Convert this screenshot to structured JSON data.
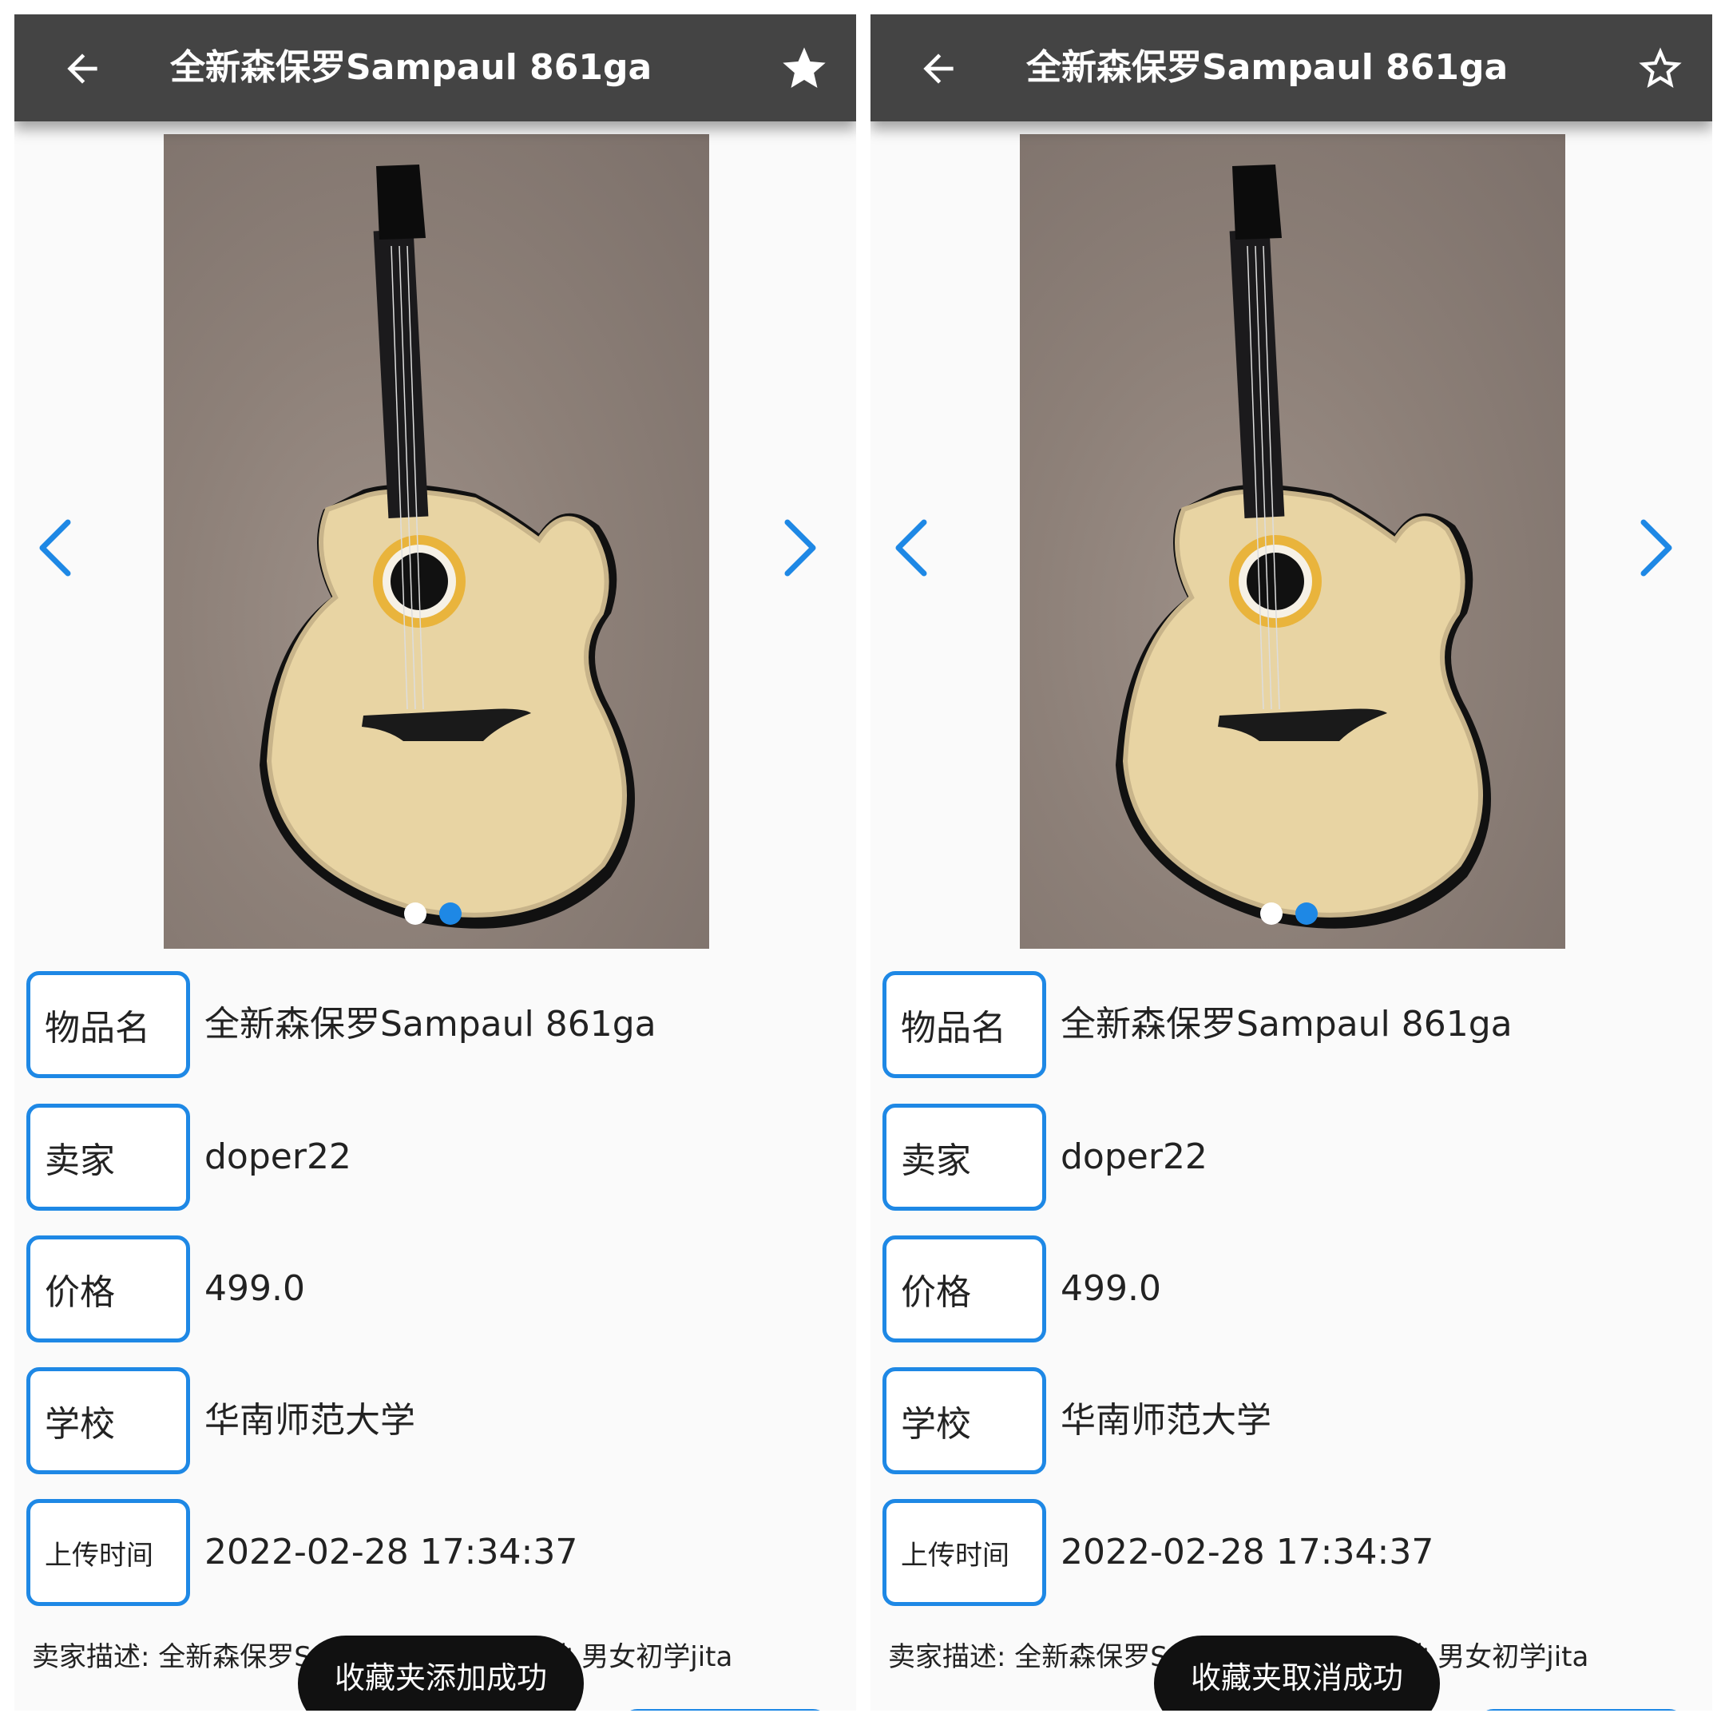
{
  "colors": {
    "appbar": "#444444",
    "accent": "#1e88e5",
    "dot_active": "#1e88e5",
    "dot_inactive": "#ffffff",
    "toast_bg": "#111111"
  },
  "screens": [
    {
      "state": "favorited",
      "appbar": {
        "title": "全新森保罗Sampaul 861ga",
        "back_icon": "arrow-left-icon",
        "favorite_icon": "star-filled-icon"
      },
      "carousel": {
        "image": "acoustic guitar photo",
        "slide_count": 2,
        "active_index": 1
      },
      "details": [
        {
          "label": "物品名",
          "value": "全新森保罗Sampaul 861ga"
        },
        {
          "label": "卖家",
          "value": "doper22"
        },
        {
          "label": "价格",
          "value": "499.0"
        },
        {
          "label": "学校",
          "value": "华南师范大学"
        },
        {
          "label": "上传时间",
          "value": "2022-02-28 17:34:37"
        }
      ],
      "description": "卖家描述: 全新森保罗S                                     单板吉他 民谣木吉他 男女初学jita",
      "toast": "收藏夹添加成功"
    },
    {
      "state": "unfavorited",
      "appbar": {
        "title": "全新森保罗Sampaul 861ga",
        "back_icon": "arrow-left-icon",
        "favorite_icon": "star-outline-icon"
      },
      "carousel": {
        "image": "acoustic guitar photo",
        "slide_count": 2,
        "active_index": 1
      },
      "details": [
        {
          "label": "物品名",
          "value": "全新森保罗Sampaul 861ga"
        },
        {
          "label": "卖家",
          "value": "doper22"
        },
        {
          "label": "价格",
          "value": "499.0"
        },
        {
          "label": "学校",
          "value": "华南师范大学"
        },
        {
          "label": "上传时间",
          "value": "2022-02-28 17:34:37"
        }
      ],
      "description": "卖家描述: 全新森保罗S                                     单板吉他 民谣木吉他 男女初学jita",
      "toast": "收藏夹取消成功"
    }
  ]
}
